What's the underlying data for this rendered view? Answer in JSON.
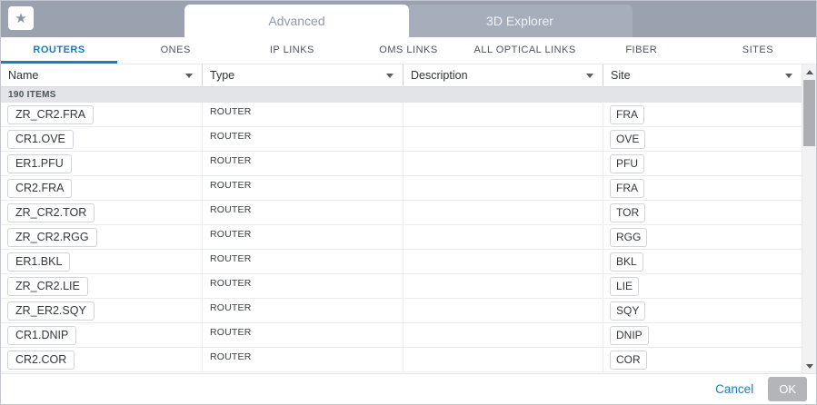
{
  "topbar": {
    "tabs": [
      {
        "label": "Advanced",
        "active": true
      },
      {
        "label": "3D Explorer",
        "active": false
      }
    ]
  },
  "subtabs": {
    "active": "ROUTERS",
    "items": [
      {
        "label": "ROUTERS"
      },
      {
        "label": "ONES"
      },
      {
        "label": "IP LINKS"
      },
      {
        "label": "OMS LINKS"
      },
      {
        "label": "ALL OPTICAL LINKS"
      },
      {
        "label": "FIBER"
      },
      {
        "label": "SITES"
      }
    ]
  },
  "table": {
    "columns": [
      {
        "label": "Name"
      },
      {
        "label": "Type"
      },
      {
        "label": "Description"
      },
      {
        "label": "Site"
      }
    ],
    "group_label": "190 ITEMS",
    "rows": [
      {
        "name": "ZR_CR2.FRA",
        "type": "ROUTER",
        "description": "",
        "site": "FRA"
      },
      {
        "name": "CR1.OVE",
        "type": "ROUTER",
        "description": "",
        "site": "OVE"
      },
      {
        "name": "ER1.PFU",
        "type": "ROUTER",
        "description": "",
        "site": "PFU"
      },
      {
        "name": "CR2.FRA",
        "type": "ROUTER",
        "description": "",
        "site": "FRA"
      },
      {
        "name": "ZR_CR2.TOR",
        "type": "ROUTER",
        "description": "",
        "site": "TOR"
      },
      {
        "name": "ZR_CR2.RGG",
        "type": "ROUTER",
        "description": "",
        "site": "RGG"
      },
      {
        "name": "ER1.BKL",
        "type": "ROUTER",
        "description": "",
        "site": "BKL"
      },
      {
        "name": "ZR_CR2.LIE",
        "type": "ROUTER",
        "description": "",
        "site": "LIE"
      },
      {
        "name": "ZR_ER2.SQY",
        "type": "ROUTER",
        "description": "",
        "site": "SQY"
      },
      {
        "name": "CR1.DNIP",
        "type": "ROUTER",
        "description": "",
        "site": "DNIP"
      },
      {
        "name": "CR2.COR",
        "type": "ROUTER",
        "description": "",
        "site": "COR"
      }
    ]
  },
  "footer": {
    "cancel_label": "Cancel",
    "ok_label": "OK"
  },
  "icons": {
    "favorites": "star-icon",
    "column_filter": "chevron-down-icon",
    "scroll_up": "triangle-up-icon",
    "scroll_down": "triangle-down-icon"
  },
  "colors": {
    "accent_blue": "#1b7cc0",
    "topbar_gray": "#9aa2b0",
    "ok_button_gray": "#b4b5b9",
    "group_row_bg": "#e3e4e8"
  }
}
